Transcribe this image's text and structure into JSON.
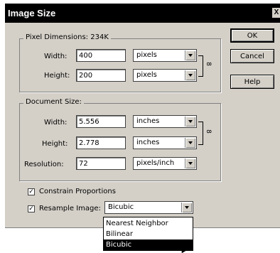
{
  "window": {
    "title": "Image Size",
    "close_glyph": "X"
  },
  "pixel_dimensions": {
    "group_label": "Pixel Dimensions:",
    "size": "234K",
    "width": {
      "label": "Width:",
      "value": "400",
      "unit": "pixels"
    },
    "height": {
      "label": "Height:",
      "value": "200",
      "unit": "pixels"
    }
  },
  "document_size": {
    "group_label": "Document Size:",
    "width": {
      "label": "Width:",
      "value": "5.556",
      "unit": "inches"
    },
    "height": {
      "label": "Height:",
      "value": "2.778",
      "unit": "inches"
    },
    "resolution": {
      "label": "Resolution:",
      "value": "72",
      "unit": "pixels/inch"
    }
  },
  "buttons": {
    "ok": "OK",
    "cancel": "Cancel",
    "help": "Help"
  },
  "options": {
    "constrain": {
      "label": "Constrain Proportions",
      "checked": true
    },
    "resample": {
      "label": "Resample Image:",
      "checked": true,
      "value": "Bicubic"
    }
  },
  "resample_menu": [
    "Nearest Neighbor",
    "Bilinear",
    "Bicubic"
  ],
  "icons": {
    "link": "link-icon",
    "cursor": "mouse-cursor-icon"
  }
}
